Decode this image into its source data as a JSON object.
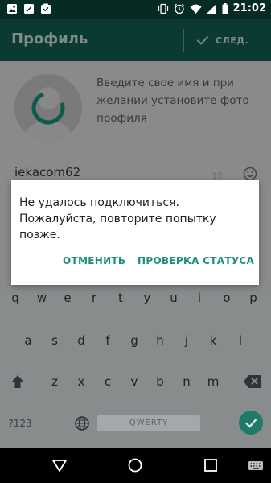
{
  "status_bar": {
    "time": "21:02",
    "left_icons": [
      "image-notification-icon",
      "edit-notification-icon",
      "message-notification-icon"
    ],
    "right_icons": [
      "vibrate-icon",
      "alarm-icon",
      "wifi-icon",
      "signal-icon",
      "battery-icon"
    ]
  },
  "app_bar": {
    "title": "Профиль",
    "next_label": "СЛЕД.",
    "next_icon": "check-icon"
  },
  "profile": {
    "instruction": "Введите свое имя и при желании установите фото профиля",
    "name_value": "iekacom62",
    "char_counter": "15",
    "emoji_icon": "smiley-icon",
    "avatar_icon": "loading-spinner-icon"
  },
  "dialog": {
    "message": "Не удалось подключиться. Пожалуйста, повторите попытку позже.",
    "cancel_label": "ОТМЕНИТЬ",
    "check_status_label": "ПРОВЕРКА СТАТУСА"
  },
  "keyboard": {
    "row1": [
      "q",
      "w",
      "e",
      "r",
      "t",
      "y",
      "u",
      "i",
      "o",
      "p"
    ],
    "row2": [
      "a",
      "s",
      "d",
      "f",
      "g",
      "h",
      "j",
      "k",
      "l"
    ],
    "row3": [
      "z",
      "x",
      "c",
      "v",
      "b",
      "n",
      "m"
    ],
    "symbols_label": "?123",
    "space_label": "QWERTY",
    "shift_icon": "shift-icon",
    "backspace_icon": "backspace-icon",
    "globe_icon": "globe-icon",
    "enter_icon": "check-icon"
  },
  "nav_bar": {
    "icons": [
      "back-icon",
      "home-icon",
      "recents-icon",
      "keyboard-switch-icon"
    ]
  },
  "colors": {
    "status_bar": "#062b24",
    "app_bar": "#0a3a31",
    "accent": "#1e8e7e",
    "scrim_content": "#8a8a8a",
    "keyboard": "#888c8d"
  }
}
